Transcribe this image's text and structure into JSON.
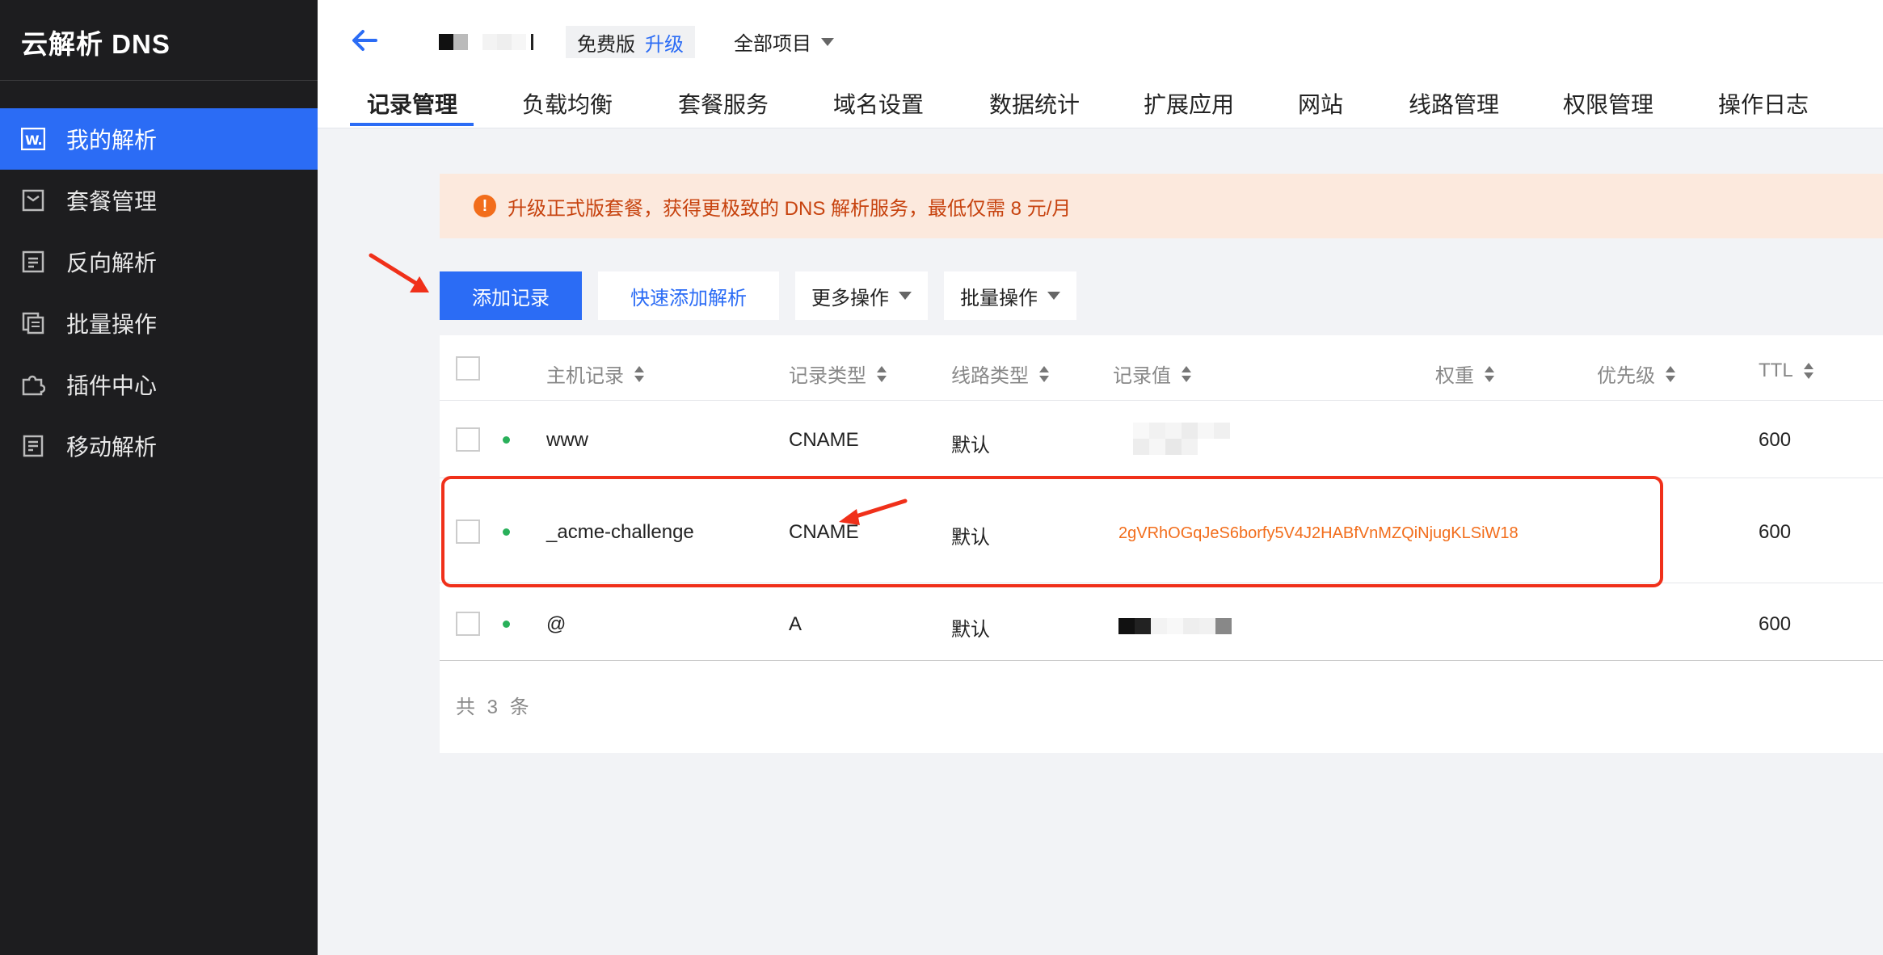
{
  "app": {
    "title": "云解析 DNS"
  },
  "sidebar": {
    "items": [
      {
        "label": "我的解析",
        "icon": "dns-record-icon",
        "active": true
      },
      {
        "label": "套餐管理",
        "icon": "package-icon",
        "active": false
      },
      {
        "label": "反向解析",
        "icon": "reverse-icon",
        "active": false
      },
      {
        "label": "批量操作",
        "icon": "batch-icon",
        "active": false
      },
      {
        "label": "插件中心",
        "icon": "plugin-icon",
        "active": false
      },
      {
        "label": "移动解析",
        "icon": "mobile-icon",
        "active": false
      }
    ]
  },
  "header": {
    "plan": "免费版",
    "upgrade": "升级",
    "project": "全部项目",
    "tabs": [
      "记录管理",
      "负载均衡",
      "套餐服务",
      "域名设置",
      "数据统计",
      "扩展应用",
      "网站",
      "线路管理",
      "权限管理",
      "操作日志"
    ],
    "active_tab": "记录管理"
  },
  "banner": {
    "text": "升级正式版套餐，获得更极致的 DNS 解析服务，最低仅需 8 元/月"
  },
  "toolbar": {
    "add_record": "添加记录",
    "quick_add": "快速添加解析",
    "more_actions": "更多操作",
    "batch_actions": "批量操作"
  },
  "table": {
    "headers": [
      "主机记录",
      "记录类型",
      "线路类型",
      "记录值",
      "权重",
      "优先级",
      "TTL"
    ],
    "rows": [
      {
        "host": "www",
        "type": "CNAME",
        "line": "默认",
        "value": "",
        "ttl": "600"
      },
      {
        "host": "_acme-challenge",
        "type": "CNAME",
        "line": "默认",
        "value": "2gVRhOGqJeS6borfy5V4J2HABfVnMZQiNjugKLSiW18",
        "ttl": "600"
      },
      {
        "host": "@",
        "type": "A",
        "line": "默认",
        "value": "",
        "ttl": "600"
      }
    ],
    "total": "共 3 条"
  },
  "colors": {
    "primary": "#2b6cf5",
    "sidebar_bg": "#1d1d1f",
    "warning": "#f26d1b",
    "highlight": "#f0301a",
    "status": "#29b05a"
  }
}
